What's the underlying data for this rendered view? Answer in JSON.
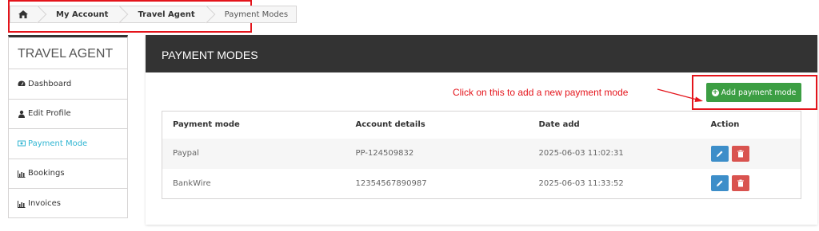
{
  "breadcrumb": {
    "items": [
      "My Account",
      "Travel Agent",
      "Payment Modes"
    ]
  },
  "sidebar": {
    "title": "TRAVEL AGENT",
    "items": [
      {
        "label": "Dashboard",
        "icon": "dashboard-icon"
      },
      {
        "label": "Edit Profile",
        "icon": "user-icon"
      },
      {
        "label": "Payment Mode",
        "icon": "payment-icon",
        "active": true
      },
      {
        "label": "Bookings",
        "icon": "bar-chart-icon"
      },
      {
        "label": "Invoices",
        "icon": "bar-chart-icon"
      }
    ]
  },
  "main": {
    "title": "PAYMENT MODES",
    "annotation": "Click on this to add a new payment mode",
    "add_button": "Add payment mode",
    "table": {
      "headers": [
        "Payment mode",
        "Account details",
        "Date add",
        "Action"
      ],
      "rows": [
        [
          "Paypal",
          "PP-124509832",
          "2025-06-03 11:02:31"
        ],
        [
          "BankWire",
          "12354567890987",
          "2025-06-03 11:33:52"
        ]
      ]
    }
  },
  "colors": {
    "accent": "#2fb5d2",
    "annotation": "#e4141b",
    "add_button": "#3c9e43",
    "edit_button": "#3d8ec9",
    "delete_button": "#d9534f",
    "header_bar": "#333333"
  }
}
